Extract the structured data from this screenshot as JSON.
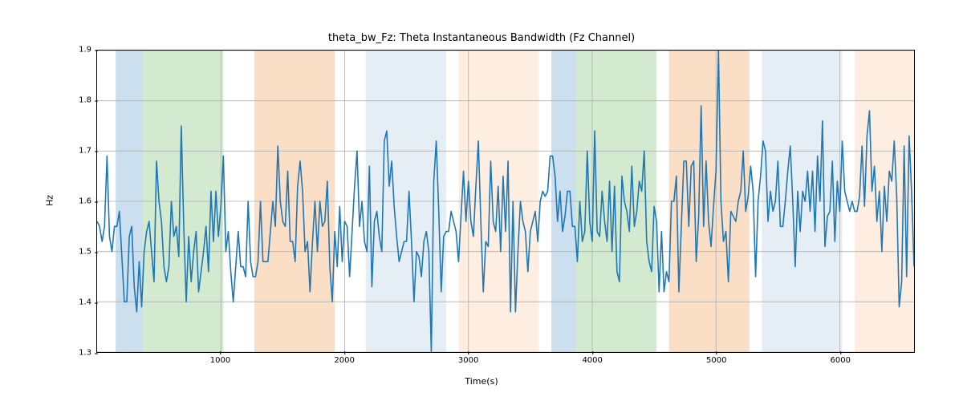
{
  "chart_data": {
    "type": "line",
    "title": "theta_bw_Fz: Theta Instantaneous Bandwidth (Fz Channel)",
    "xlabel": "Time(s)",
    "ylabel": "Hz",
    "xlim": [
      0,
      6600
    ],
    "ylim": [
      1.3,
      1.9
    ],
    "xticks": [
      1000,
      2000,
      3000,
      4000,
      5000,
      6000
    ],
    "yticks": [
      1.3,
      1.4,
      1.5,
      1.6,
      1.7,
      1.8,
      1.9
    ],
    "line_color": "#1f77b4",
    "grid": true,
    "regions": [
      {
        "x0": 150,
        "x1": 370,
        "color": "#a8c9e3"
      },
      {
        "x0": 370,
        "x1": 1020,
        "color": "#b6dbb0"
      },
      {
        "x0": 1270,
        "x1": 1920,
        "color": "#f6caa0"
      },
      {
        "x0": 2170,
        "x1": 2820,
        "color": "#d4e2ef"
      },
      {
        "x0": 2920,
        "x1": 3570,
        "color": "#fbe3cd"
      },
      {
        "x0": 3670,
        "x1": 3870,
        "color": "#a8c9e3"
      },
      {
        "x0": 3870,
        "x1": 4520,
        "color": "#b6dbb0"
      },
      {
        "x0": 4620,
        "x1": 5270,
        "color": "#f6caa0"
      },
      {
        "x0": 5370,
        "x1": 6020,
        "color": "#d4e2ef"
      },
      {
        "x0": 6120,
        "x1": 6600,
        "color": "#fbe3cd"
      }
    ],
    "series": [
      {
        "name": "theta_bw_Fz",
        "x_step": 20,
        "x_start": 0,
        "values": [
          1.56,
          1.55,
          1.52,
          1.55,
          1.69,
          1.53,
          1.5,
          1.55,
          1.55,
          1.58,
          1.49,
          1.4,
          1.4,
          1.53,
          1.55,
          1.43,
          1.38,
          1.48,
          1.39,
          1.5,
          1.54,
          1.56,
          1.5,
          1.44,
          1.68,
          1.6,
          1.56,
          1.47,
          1.44,
          1.47,
          1.6,
          1.53,
          1.55,
          1.49,
          1.75,
          1.55,
          1.4,
          1.53,
          1.44,
          1.5,
          1.54,
          1.42,
          1.46,
          1.5,
          1.55,
          1.46,
          1.62,
          1.52,
          1.62,
          1.53,
          1.59,
          1.69,
          1.5,
          1.54,
          1.46,
          1.4,
          1.47,
          1.54,
          1.47,
          1.47,
          1.45,
          1.6,
          1.48,
          1.45,
          1.45,
          1.48,
          1.6,
          1.48,
          1.48,
          1.48,
          1.54,
          1.6,
          1.55,
          1.71,
          1.6,
          1.56,
          1.55,
          1.66,
          1.52,
          1.52,
          1.48,
          1.63,
          1.68,
          1.62,
          1.5,
          1.52,
          1.42,
          1.52,
          1.6,
          1.5,
          1.6,
          1.55,
          1.56,
          1.64,
          1.47,
          1.4,
          1.54,
          1.47,
          1.59,
          1.48,
          1.56,
          1.55,
          1.45,
          1.54,
          1.63,
          1.7,
          1.55,
          1.6,
          1.52,
          1.5,
          1.67,
          1.43,
          1.56,
          1.58,
          1.53,
          1.5,
          1.72,
          1.74,
          1.63,
          1.68,
          1.59,
          1.53,
          1.48,
          1.5,
          1.52,
          1.52,
          1.62,
          1.52,
          1.4,
          1.5,
          1.49,
          1.45,
          1.52,
          1.54,
          1.5,
          1.3,
          1.64,
          1.72,
          1.58,
          1.42,
          1.53,
          1.54,
          1.54,
          1.58,
          1.56,
          1.54,
          1.48,
          1.57,
          1.66,
          1.56,
          1.64,
          1.56,
          1.53,
          1.63,
          1.72,
          1.56,
          1.42,
          1.52,
          1.51,
          1.68,
          1.56,
          1.54,
          1.63,
          1.5,
          1.65,
          1.54,
          1.68,
          1.38,
          1.6,
          1.38,
          1.5,
          1.6,
          1.56,
          1.54,
          1.46,
          1.54,
          1.56,
          1.58,
          1.52,
          1.6,
          1.62,
          1.61,
          1.62,
          1.69,
          1.69,
          1.65,
          1.56,
          1.62,
          1.54,
          1.57,
          1.62,
          1.62,
          1.55,
          1.55,
          1.48,
          1.6,
          1.52,
          1.54,
          1.7,
          1.56,
          1.52,
          1.74,
          1.54,
          1.53,
          1.62,
          1.56,
          1.52,
          1.64,
          1.5,
          1.63,
          1.46,
          1.44,
          1.65,
          1.6,
          1.58,
          1.54,
          1.67,
          1.55,
          1.58,
          1.64,
          1.62,
          1.7,
          1.52,
          1.48,
          1.46,
          1.59,
          1.56,
          1.42,
          1.54,
          1.42,
          1.46,
          1.44,
          1.6,
          1.6,
          1.65,
          1.42,
          1.55,
          1.68,
          1.68,
          1.55,
          1.67,
          1.68,
          1.48,
          1.57,
          1.79,
          1.55,
          1.68,
          1.56,
          1.51,
          1.59,
          1.66,
          1.9,
          1.6,
          1.52,
          1.54,
          1.44,
          1.58,
          1.57,
          1.56,
          1.6,
          1.62,
          1.7,
          1.58,
          1.61,
          1.67,
          1.62,
          1.45,
          1.6,
          1.65,
          1.72,
          1.7,
          1.56,
          1.62,
          1.58,
          1.6,
          1.68,
          1.55,
          1.55,
          1.6,
          1.66,
          1.71,
          1.6,
          1.47,
          1.62,
          1.54,
          1.62,
          1.6,
          1.66,
          1.58,
          1.66,
          1.54,
          1.69,
          1.6,
          1.76,
          1.51,
          1.57,
          1.58,
          1.68,
          1.52,
          1.64,
          1.58,
          1.72,
          1.62,
          1.6,
          1.58,
          1.6,
          1.58,
          1.58,
          1.61,
          1.71,
          1.59,
          1.73,
          1.78,
          1.62,
          1.67,
          1.56,
          1.62,
          1.5,
          1.63,
          1.56,
          1.66,
          1.64,
          1.72,
          1.61,
          1.39,
          1.44,
          1.71,
          1.45,
          1.73,
          1.62,
          1.47
        ]
      }
    ]
  }
}
